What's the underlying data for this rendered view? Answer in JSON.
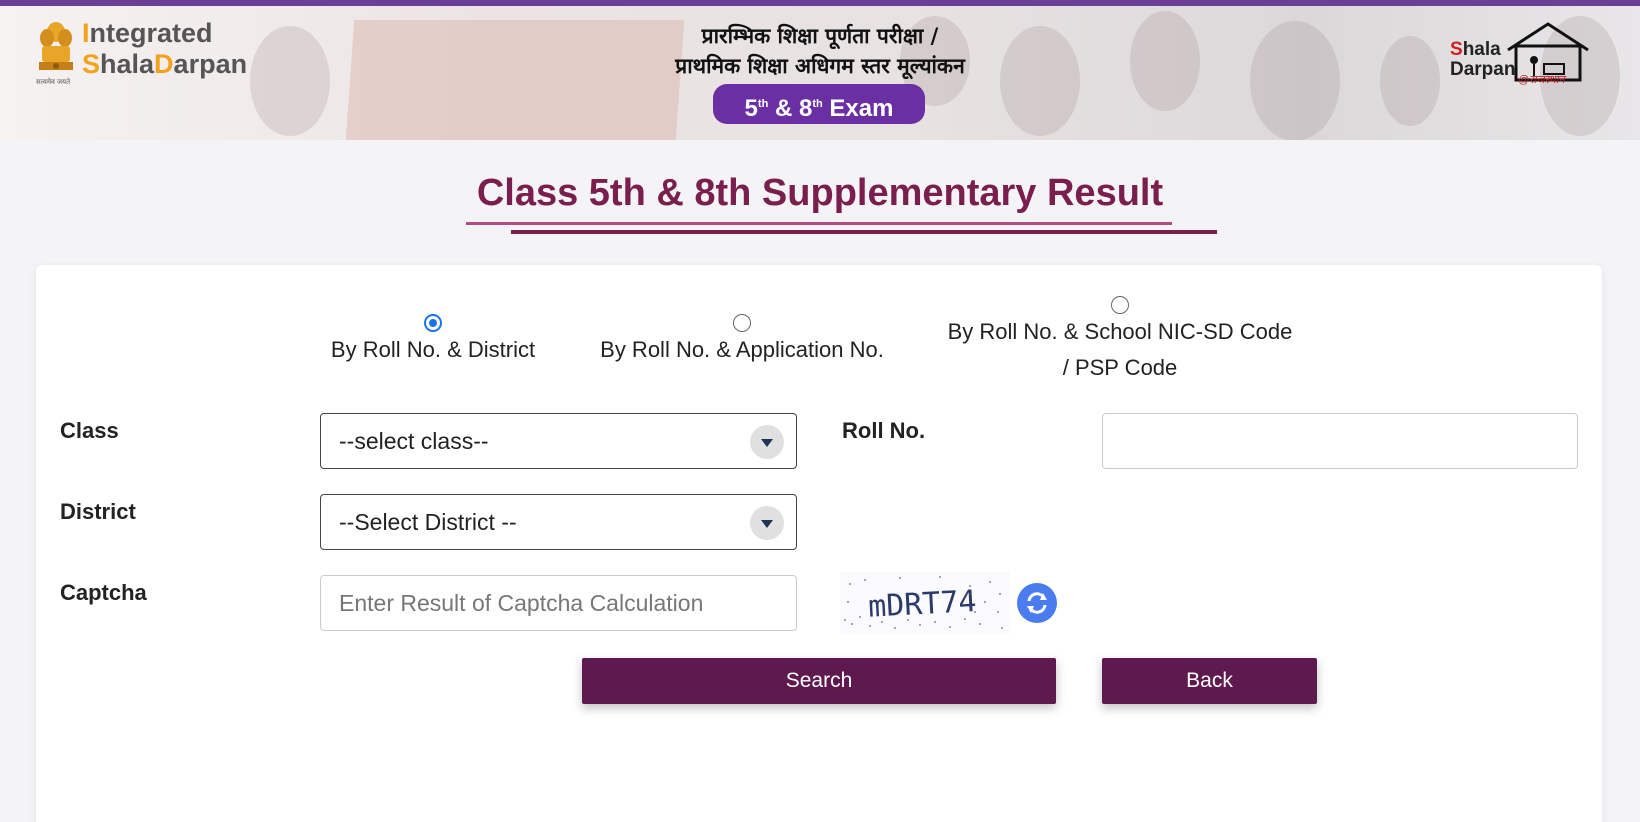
{
  "header": {
    "brand_line1": "Integrated",
    "brand_line2_a": "Shala",
    "brand_line2_b": "Darpan",
    "emblem_caption": "सत्यमेव जयते",
    "hindi_line1": "प्रारम्भिक शिक्षा पूर्णता परीक्षा /",
    "hindi_line2": "प्राथमिक शिक्षा अधिगम स्तर मूल्यांकन",
    "exam_5": "5",
    "exam_th1": "th",
    "exam_amp": "&",
    "exam_8": "8",
    "exam_th2": "th",
    "exam_word": "Exam",
    "shala_S": "S",
    "shala_rest": "hala",
    "shala_darpan": "Darpan",
    "shala_sub": "@राजस्थान"
  },
  "page_title": "Class 5th & 8th Supplementary Result",
  "search_options": [
    {
      "label": "By Roll No. & District",
      "checked": true
    },
    {
      "label": "By Roll No. & Application No.",
      "checked": false
    },
    {
      "label_line1": "By Roll No. & School NIC-SD Code",
      "label_line2": "/ PSP Code",
      "checked": false
    }
  ],
  "form": {
    "class_label": "Class",
    "class_value": "--select class--",
    "roll_label": "Roll No.",
    "roll_value": "",
    "district_label": "District",
    "district_value": "--Select District --",
    "captcha_label": "Captcha",
    "captcha_placeholder": "Enter Result of Captcha Calculation",
    "captcha_text": "mDRT74"
  },
  "buttons": {
    "search": "Search",
    "back": "Back"
  },
  "colors": {
    "accent": "#5e1a4f",
    "title": "#7a1e4e",
    "radio": "#1a73e8",
    "exam_pill": "#6b2fa4",
    "brand_orange": "#f4a21b"
  },
  "icons": [
    "emblem-icon",
    "shala-darpan-logo-icon",
    "refresh-icon",
    "chevron-down-icon"
  ]
}
